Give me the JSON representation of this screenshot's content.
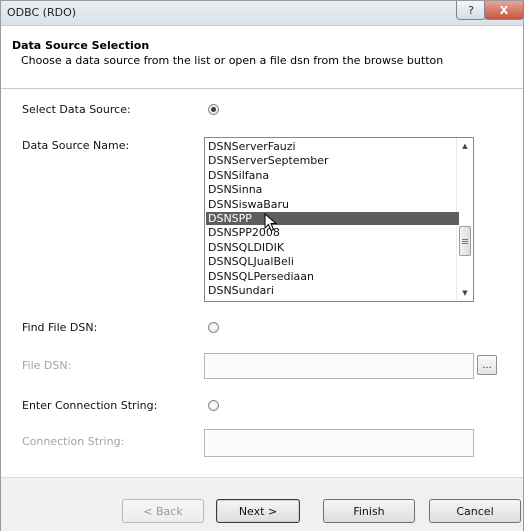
{
  "window": {
    "title": "ODBC (RDO)",
    "help_glyph": "?",
    "close_glyph": "X"
  },
  "header": {
    "title": "Data Source Selection",
    "subtitle": "Choose a data source from the list or open a file dsn from the browse button"
  },
  "labels": {
    "select_data_source": "Select Data Source:",
    "data_source_name": "Data Source Name:",
    "find_file_dsn": "Find File DSN:",
    "file_dsn": "File DSN:",
    "enter_connection_string": "Enter Connection String:",
    "connection_string": "Connection String:"
  },
  "radios": {
    "select_data_source": true,
    "find_file_dsn": false,
    "enter_connection_string": false
  },
  "data_sources": {
    "items": [
      "DSNServerFauzi",
      "DSNServerSeptember",
      "DSNSilfana",
      "DSNSinna",
      "DSNSiswaBaru",
      "DSNSPP",
      "DSNSPP2008",
      "DSNSQLDIDIK",
      "DSNSQLJualBeli",
      "DSNSQLPersediaan",
      "DSNSundari"
    ],
    "selected": "DSNSPP"
  },
  "file_dsn": {
    "value": "",
    "browse_label": "..."
  },
  "connection_string": {
    "value": ""
  },
  "buttons": {
    "back": "< Back",
    "next": "Next >",
    "finish": "Finish",
    "cancel": "Cancel"
  }
}
